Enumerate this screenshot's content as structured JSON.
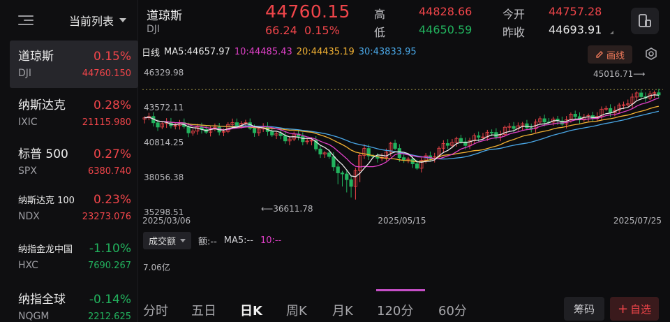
{
  "sidebar": {
    "title": "当前列表",
    "items": [
      {
        "name": "道琼斯",
        "code": "DJI",
        "pct": "0.15%",
        "price": "44760.150",
        "dir": "up"
      },
      {
        "name": "纳斯达克",
        "code": "IXIC",
        "pct": "0.28%",
        "price": "21115.980",
        "dir": "up"
      },
      {
        "name": "标普 500",
        "code": "SPX",
        "pct": "0.27%",
        "price": "6380.740",
        "dir": "up"
      },
      {
        "name": "纳斯达克 100",
        "code": "NDX",
        "pct": "0.23%",
        "price": "23273.076",
        "dir": "up"
      },
      {
        "name": "纳指金龙中国",
        "code": "HXC",
        "pct": "-1.10%",
        "price": "7690.267",
        "dir": "down"
      },
      {
        "name": "纳指全球",
        "code": "NQGM",
        "pct": "-0.14%",
        "price": "2212.625",
        "dir": "down"
      }
    ]
  },
  "header": {
    "name": "道琼斯",
    "code": "DJI",
    "price": "44760.15",
    "change": "66.24",
    "change_pct": "0.15%",
    "high_label": "高",
    "high": "44828.66",
    "low_label": "低",
    "low": "44650.59",
    "open_label": "今开",
    "open": "44757.28",
    "prev_label": "昨收",
    "prev": "44693.91"
  },
  "ma": {
    "period": "日线",
    "ma5": "MA5:44657.97",
    "ma10": "10:44485.43",
    "ma20": "20:44435.19",
    "ma30": "30:43833.95"
  },
  "draw_label": "画线",
  "chart_data": {
    "type": "candlestick",
    "y_ticks": [
      "46329.98",
      "43572.11",
      "40814.25",
      "38056.38",
      "35298.51"
    ],
    "x_ticks": [
      "2025/03/06",
      "2025/05/15",
      "2025/07/25"
    ],
    "annotations": {
      "high": "45016.71",
      "low": "36611.78"
    },
    "colors": {
      "up": "#f0454a",
      "down": "#22b35e",
      "ma5": "#e8e8e8",
      "ma10": "#e040c8",
      "ma20": "#f2b233",
      "ma30": "#4aa8e8"
    }
  },
  "volume": {
    "selector": "成交额",
    "amount": "额:--",
    "ma5": "MA5:--",
    "ma10": "10:--",
    "axis_label": "7.06亿"
  },
  "tabs": [
    "分时",
    "五日",
    "日K",
    "周K",
    "月K",
    "120分",
    "60分"
  ],
  "chip_label": "筹码",
  "fav_label": "自选"
}
